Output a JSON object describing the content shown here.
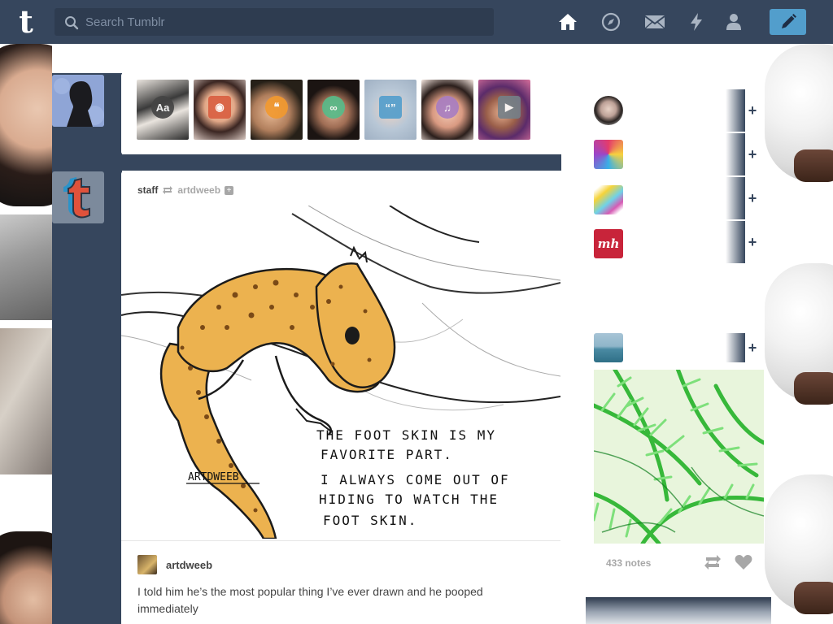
{
  "header": {
    "logo": "t",
    "search_placeholder": "Search Tumblr",
    "nav": [
      "home-icon",
      "explore-icon",
      "inbox-icon",
      "activity-icon",
      "account-icon"
    ],
    "compose_icon": "pencil-icon",
    "bg_color": "#36465d",
    "accent": "#529ecc"
  },
  "post_types": [
    {
      "name": "text",
      "label": "Aa",
      "color": "#444444"
    },
    {
      "name": "photo",
      "label": "",
      "color": "#d95e40"
    },
    {
      "name": "quote",
      "label": "",
      "color": "#f2992e"
    },
    {
      "name": "link",
      "label": "",
      "color": "#56bc8a"
    },
    {
      "name": "chat",
      "label": "",
      "color": "#529ecc"
    },
    {
      "name": "audio",
      "label": "",
      "color": "#a77dc2"
    },
    {
      "name": "video",
      "label": "",
      "color": "#748089"
    }
  ],
  "post": {
    "blog": "staff",
    "reblogged_from": "artdweeb",
    "art_caption": [
      "THE FOOT SKIN IS MY",
      "FAVORITE PART.",
      "I ALWAYS COME OUT OF",
      "HIDING TO WATCH THE",
      "FOOT SKIN."
    ],
    "art_signature": "ARTDWEEB",
    "reblog_user": "artdweeb",
    "text": "I told him he’s the most popular thing I’ve ever drawn and he pooped immediately"
  },
  "radar": {
    "notes": "433 notes"
  }
}
